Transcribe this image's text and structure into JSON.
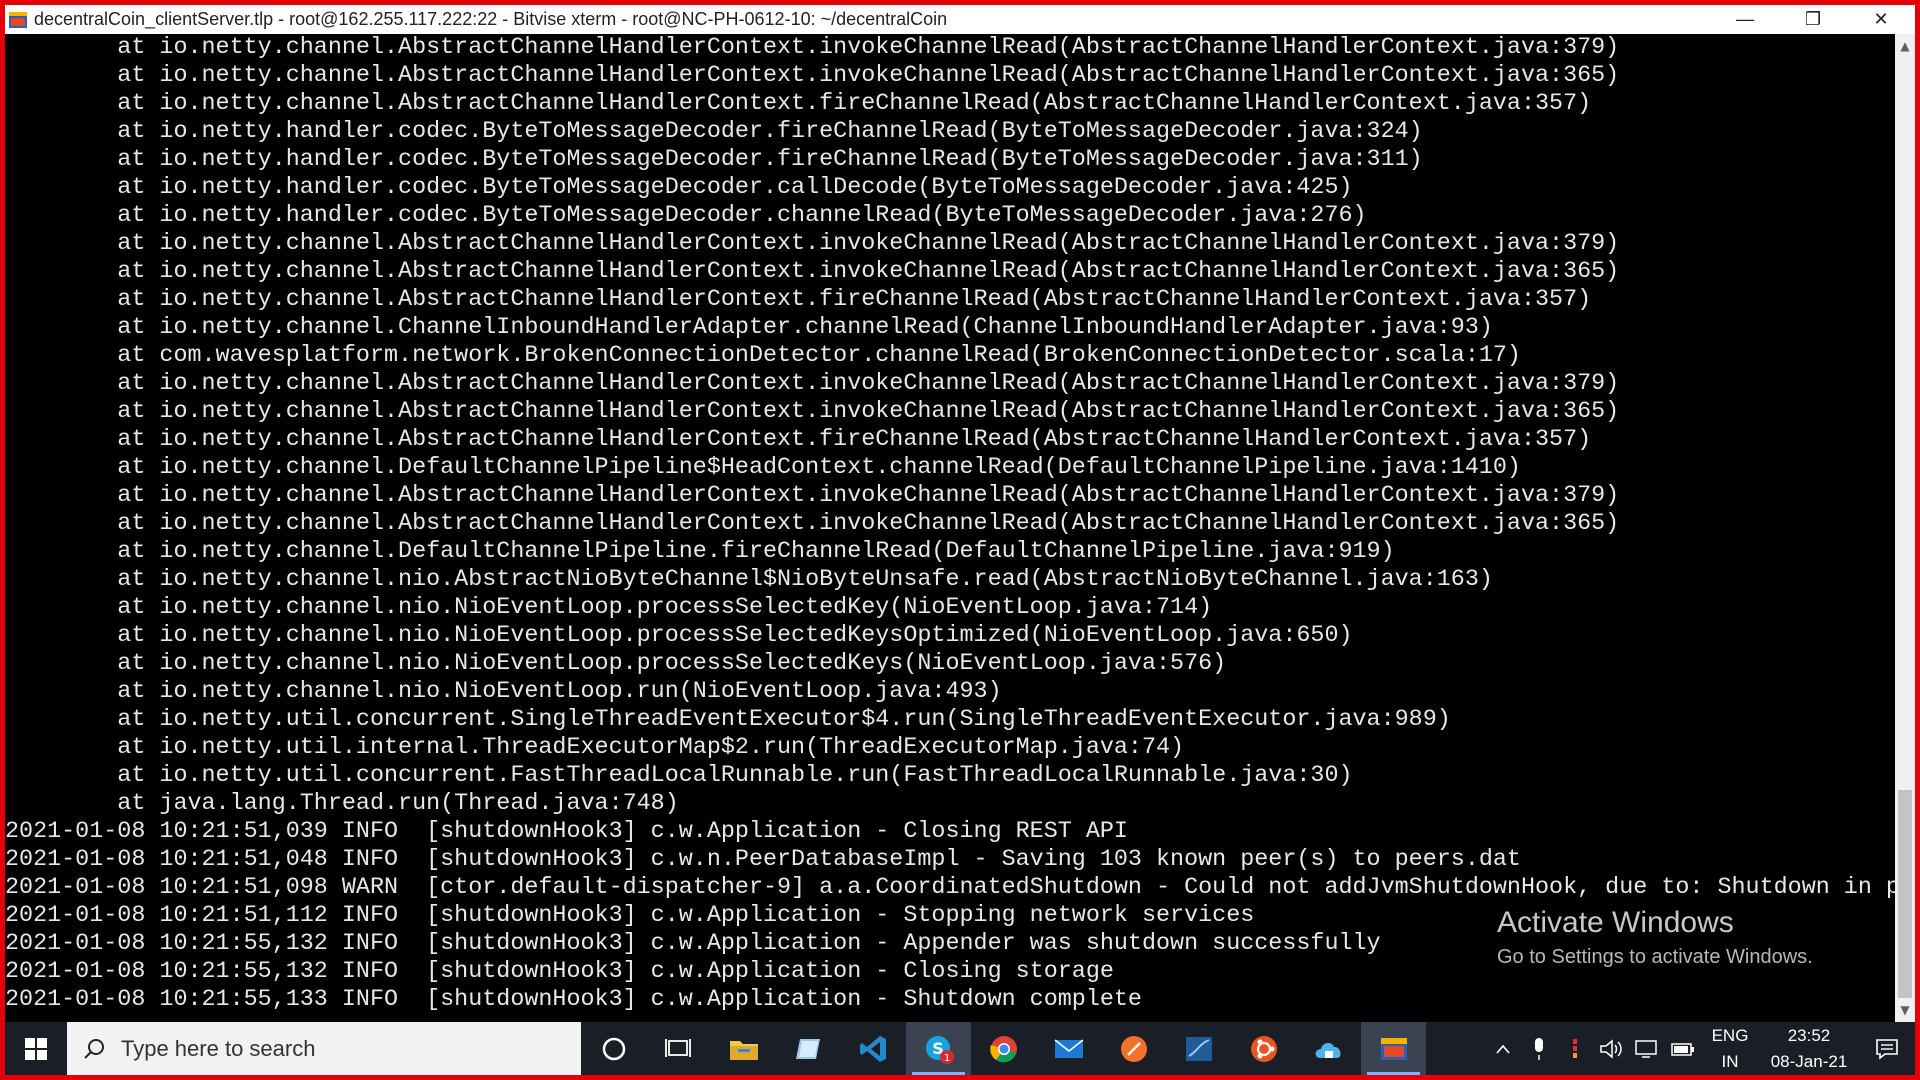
{
  "window": {
    "title": "decentralCoin_clientServer.tlp - root@162.255.117.222:22 - Bitvise xterm - root@NC-PH-0612-10: ~/decentralCoin",
    "minimize": "—",
    "maximize": "❐",
    "close": "✕"
  },
  "terminal": {
    "lines": [
      "        at io.netty.channel.AbstractChannelHandlerContext.invokeChannelRead(AbstractChannelHandlerContext.java:379)",
      "        at io.netty.channel.AbstractChannelHandlerContext.invokeChannelRead(AbstractChannelHandlerContext.java:365)",
      "        at io.netty.channel.AbstractChannelHandlerContext.fireChannelRead(AbstractChannelHandlerContext.java:357)",
      "        at io.netty.handler.codec.ByteToMessageDecoder.fireChannelRead(ByteToMessageDecoder.java:324)",
      "        at io.netty.handler.codec.ByteToMessageDecoder.fireChannelRead(ByteToMessageDecoder.java:311)",
      "        at io.netty.handler.codec.ByteToMessageDecoder.callDecode(ByteToMessageDecoder.java:425)",
      "        at io.netty.handler.codec.ByteToMessageDecoder.channelRead(ByteToMessageDecoder.java:276)",
      "        at io.netty.channel.AbstractChannelHandlerContext.invokeChannelRead(AbstractChannelHandlerContext.java:379)",
      "        at io.netty.channel.AbstractChannelHandlerContext.invokeChannelRead(AbstractChannelHandlerContext.java:365)",
      "        at io.netty.channel.AbstractChannelHandlerContext.fireChannelRead(AbstractChannelHandlerContext.java:357)",
      "        at io.netty.channel.ChannelInboundHandlerAdapter.channelRead(ChannelInboundHandlerAdapter.java:93)",
      "        at com.wavesplatform.network.BrokenConnectionDetector.channelRead(BrokenConnectionDetector.scala:17)",
      "        at io.netty.channel.AbstractChannelHandlerContext.invokeChannelRead(AbstractChannelHandlerContext.java:379)",
      "        at io.netty.channel.AbstractChannelHandlerContext.invokeChannelRead(AbstractChannelHandlerContext.java:365)",
      "        at io.netty.channel.AbstractChannelHandlerContext.fireChannelRead(AbstractChannelHandlerContext.java:357)",
      "        at io.netty.channel.DefaultChannelPipeline$HeadContext.channelRead(DefaultChannelPipeline.java:1410)",
      "        at io.netty.channel.AbstractChannelHandlerContext.invokeChannelRead(AbstractChannelHandlerContext.java:379)",
      "        at io.netty.channel.AbstractChannelHandlerContext.invokeChannelRead(AbstractChannelHandlerContext.java:365)",
      "        at io.netty.channel.DefaultChannelPipeline.fireChannelRead(DefaultChannelPipeline.java:919)",
      "        at io.netty.channel.nio.AbstractNioByteChannel$NioByteUnsafe.read(AbstractNioByteChannel.java:163)",
      "        at io.netty.channel.nio.NioEventLoop.processSelectedKey(NioEventLoop.java:714)",
      "        at io.netty.channel.nio.NioEventLoop.processSelectedKeysOptimized(NioEventLoop.java:650)",
      "        at io.netty.channel.nio.NioEventLoop.processSelectedKeys(NioEventLoop.java:576)",
      "        at io.netty.channel.nio.NioEventLoop.run(NioEventLoop.java:493)",
      "        at io.netty.util.concurrent.SingleThreadEventExecutor$4.run(SingleThreadEventExecutor.java:989)",
      "        at io.netty.util.internal.ThreadExecutorMap$2.run(ThreadExecutorMap.java:74)",
      "        at io.netty.util.concurrent.FastThreadLocalRunnable.run(FastThreadLocalRunnable.java:30)",
      "        at java.lang.Thread.run(Thread.java:748)",
      "2021-01-08 10:21:51,039 INFO  [shutdownHook3] c.w.Application - Closing REST API",
      "2021-01-08 10:21:51,048 INFO  [shutdownHook3] c.w.n.PeerDatabaseImpl - Saving 103 known peer(s) to peers.dat",
      "2021-01-08 10:21:51,098 WARN  [ctor.default-dispatcher-9] a.a.CoordinatedShutdown - Could not addJvmShutdownHook, due to: Shutdown in progress",
      "2021-01-08 10:21:51,112 INFO  [shutdownHook3] c.w.Application - Stopping network services",
      "2021-01-08 10:21:55,132 INFO  [shutdownHook3] c.w.Application - Appender was shutdown successfully",
      "2021-01-08 10:21:55,132 INFO  [shutdownHook3] c.w.Application - Closing storage",
      "2021-01-08 10:21:55,133 INFO  [shutdownHook3] c.w.Application - Shutdown complete"
    ]
  },
  "watermark": {
    "title": "Activate Windows",
    "subtitle": "Go to Settings to activate Windows."
  },
  "scrollbar": {
    "up": "▲",
    "down": "▼"
  },
  "taskbar": {
    "search_placeholder": "Type here to search",
    "lang_top": "ENG",
    "lang_bottom": "IN",
    "time": "23:52",
    "date": "08-Jan-21",
    "skype_badge": "1"
  },
  "colors": {
    "frame": "#e3000b",
    "terminal_bg": "#000000",
    "terminal_fg": "#e8e8e8",
    "taskbar_bg": "#1a1e26"
  }
}
